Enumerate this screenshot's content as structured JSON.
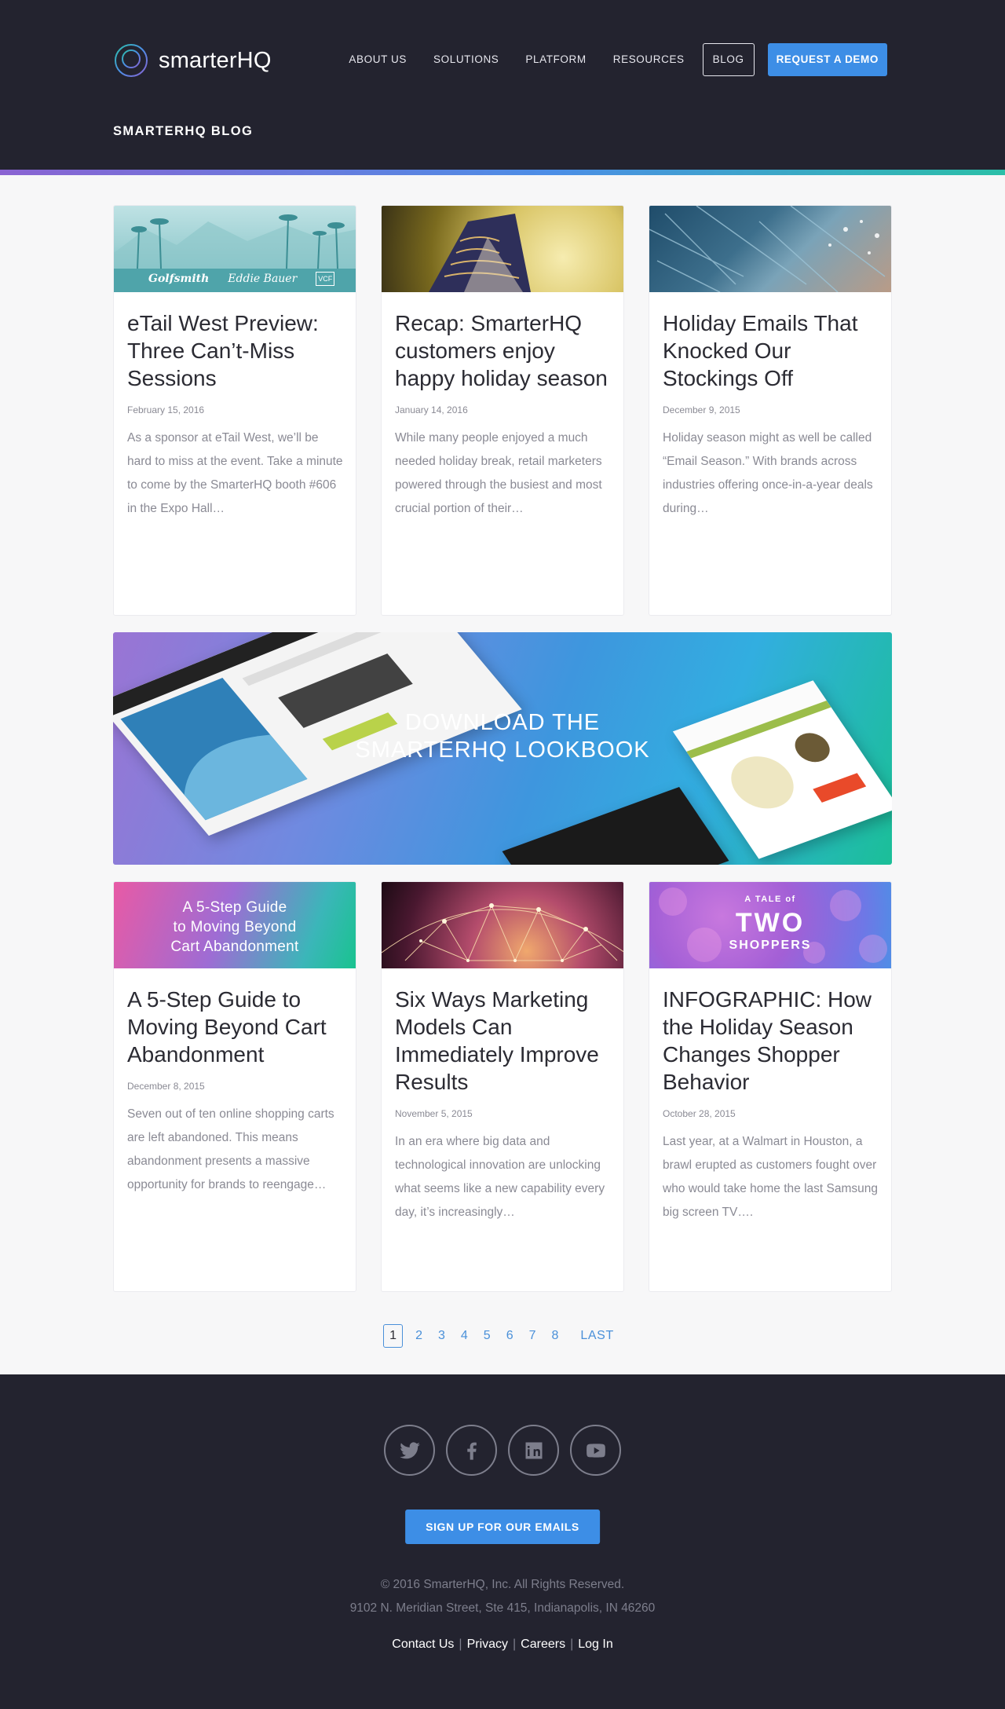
{
  "header": {
    "logo_text": "smarterHQ",
    "nav": {
      "about": "ABOUT US",
      "solutions": "SOLUTIONS",
      "platform": "PLATFORM",
      "resources": "RESOURCES",
      "blog": "BLOG",
      "demo": "REQUEST A DEMO"
    },
    "page_title": "SMARTERHQ BLOG",
    "accent_color": "#3d8ee6"
  },
  "posts_top": [
    {
      "image_brands": [
        "Golfsmith",
        "Eddie Bauer",
        "VCF"
      ],
      "title": "eTail West Preview: Three Can’t-Miss Sessions",
      "date": "February 15, 2016",
      "excerpt": "As a sponsor at eTail West, we’ll be hard to miss at the event. Take a minute to come by the SmarterHQ booth #606 in the Expo Hall…"
    },
    {
      "title": "Recap: SmarterHQ customers enjoy happy holiday season",
      "date": "January 14, 2016",
      "excerpt": "While many people enjoyed a much needed holiday break, retail marketers powered through the busiest and most crucial portion of their…"
    },
    {
      "title": "Holiday Emails That Knocked Our Stockings Off",
      "date": "December 9, 2015",
      "excerpt": "Holiday season might as well be called “Email Season.” With brands across industries offering once-in-a-year deals during…"
    }
  ],
  "banner": {
    "line1": "DOWNLOAD THE",
    "line2": "SMARTERHQ LOOKBOOK"
  },
  "posts_bottom": [
    {
      "image_caption": [
        "A 5-Step Guide",
        "to Moving Beyond",
        "Cart Abandonment"
      ],
      "title": "A 5-Step Guide to Moving Beyond Cart Abandonment",
      "date": "December 8, 2015",
      "excerpt": "Seven out of ten online shopping carts are left abandoned. This means abandonment presents a massive opportunity for brands to reengage…"
    },
    {
      "title": "Six Ways Marketing Models Can Immediately Improve Results",
      "date": "November 5, 2015",
      "excerpt": "In an era where big data and technological innovation are unlocking what seems like a new capability every day, it’s increasingly…"
    },
    {
      "image_caption": {
        "small": "A TALE of",
        "big": "TWO",
        "sub": "SHOPPERS"
      },
      "title": "INFOGRAPHIC: How the Holiday Season Changes Shopper Behavior",
      "date": "October 28, 2015",
      "excerpt": "Last year, at a Walmart in Houston, a brawl erupted as customers fought over who would take home the last Samsung big screen TV…."
    }
  ],
  "pagination": {
    "current": "1",
    "pages": [
      "2",
      "3",
      "4",
      "5",
      "6",
      "7",
      "8"
    ],
    "last": "LAST"
  },
  "footer": {
    "socials": [
      "twitter-icon",
      "facebook-icon",
      "linkedin-icon",
      "youtube-icon"
    ],
    "signup": "SIGN UP FOR OUR EMAILS",
    "copyright": "© 2016 SmarterHQ, Inc. All Rights Reserved.",
    "address": "9102 N. Meridian Street, Ste 415, Indianapolis, IN 46260",
    "links": [
      "Contact Us",
      "Privacy",
      "Careers",
      "Log In"
    ],
    "separator": "|"
  }
}
